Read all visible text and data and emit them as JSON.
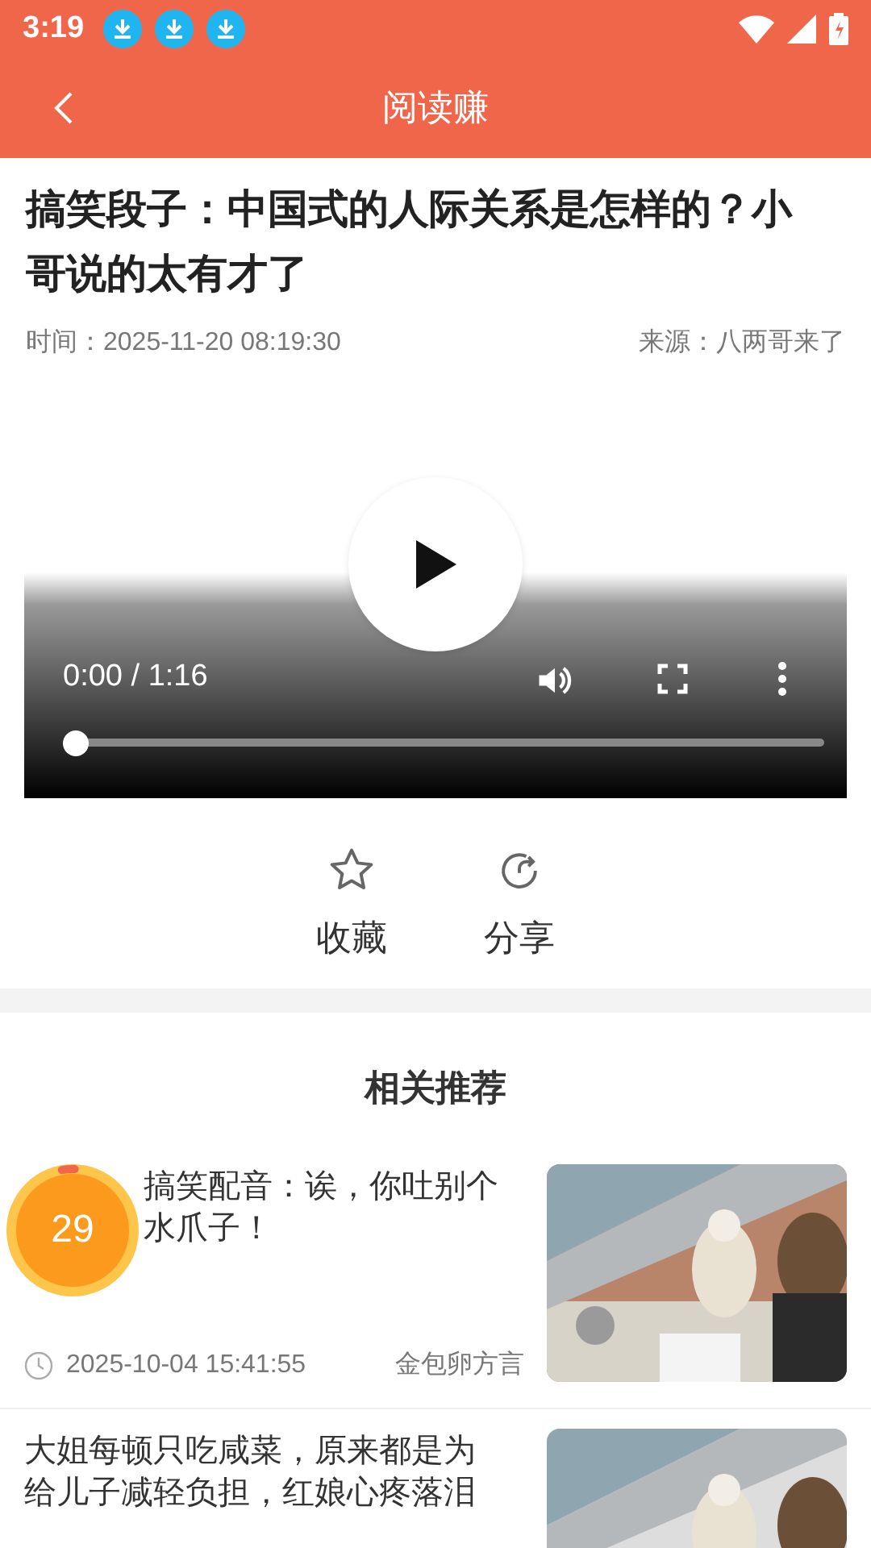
{
  "status_bar": {
    "time": "3:19",
    "notifications": [
      {
        "kind": "download"
      },
      {
        "kind": "download"
      },
      {
        "kind": "download"
      }
    ]
  },
  "header": {
    "title": "阅读赚"
  },
  "article": {
    "title": "搞笑段子：中国式的人际关系是怎样的？小哥说的太有才了",
    "time": "时间：2025-11-20 08:19:30",
    "source": "来源：八两哥来了"
  },
  "video": {
    "time": "0:00 / 1:16",
    "level": 0
  },
  "actions": [
    {
      "kind": "star",
      "label": "收藏"
    },
    {
      "kind": "share",
      "label": "分享"
    }
  ],
  "related": {
    "title": "相关推荐",
    "items": [
      {
        "title_lines": [
          "搞笑配音：诶，你吐别个",
          "水爪子！"
        ],
        "date": "2025-10-04 15:41:55",
        "source": "金包卵方言"
      },
      {
        "title_lines": [
          "大姐每顿只吃咸菜，原来都是为",
          "给儿子减轻负担，红娘心疼落泪"
        ]
      }
    ]
  },
  "timer": {
    "count": "29"
  }
}
